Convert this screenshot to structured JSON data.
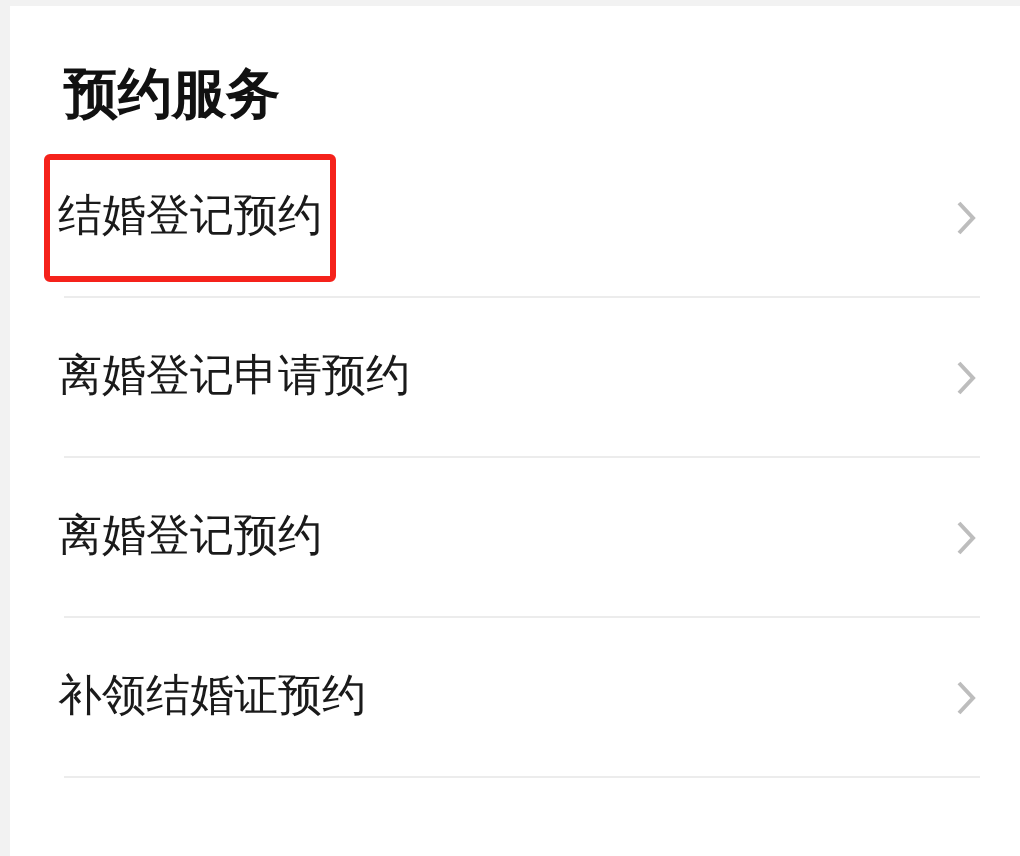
{
  "section_title": "预约服务",
  "items": [
    {
      "label": "结婚登记预约",
      "highlighted": true
    },
    {
      "label": "离婚登记申请预约",
      "highlighted": false
    },
    {
      "label": "离婚登记预约",
      "highlighted": false
    },
    {
      "label": "补领结婚证预约",
      "highlighted": false
    }
  ]
}
